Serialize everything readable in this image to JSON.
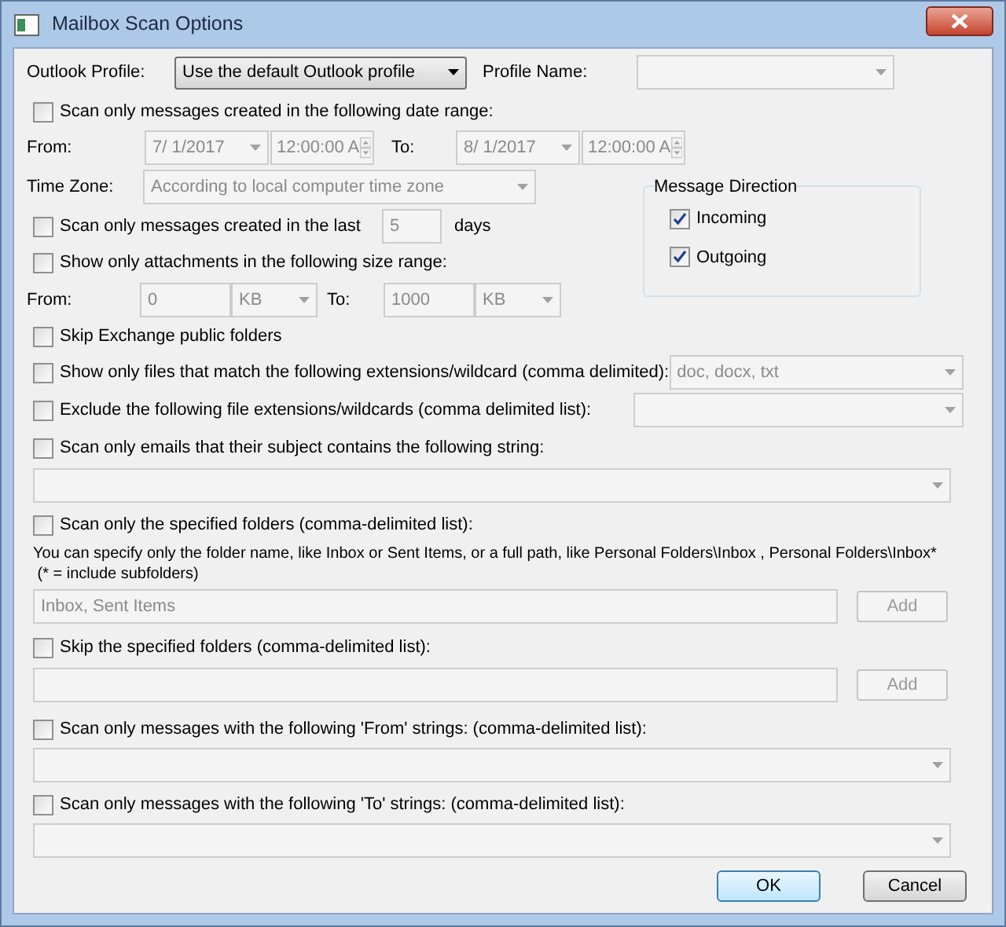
{
  "window": {
    "title": "Mailbox Scan Options"
  },
  "profile": {
    "label": "Outlook Profile:",
    "value": "Use the default Outlook profile",
    "name_label": "Profile Name:",
    "name_disabled": true
  },
  "date_range": {
    "option": {
      "label": "Scan only messages created in the following date range:",
      "checked": false
    },
    "from_label": "From:",
    "from_date": "7/  1/2017",
    "from_time": "12:00:00 A",
    "to_label": "To:",
    "to_date": "8/  1/2017",
    "to_time": "12:00:00 A",
    "disabled": true
  },
  "time_zone": {
    "label": "Time Zone:",
    "value": "According to local computer time zone",
    "disabled": true
  },
  "recent": {
    "option": {
      "label": "Scan only messages created in the last",
      "checked": false
    },
    "value": "5",
    "unit": "days",
    "disabled": true
  },
  "size_range": {
    "option": {
      "label": "Show only attachments in the following size range:",
      "checked": false
    },
    "from_label": "From:",
    "from_value": "0",
    "from_unit": "KB",
    "to_label": "To:",
    "to_value": "1000",
    "to_unit": "KB",
    "disabled": true
  },
  "message_direction": {
    "title": "Message Direction",
    "options": [
      {
        "label": "Incoming",
        "checked": true
      },
      {
        "label": "Outgoing",
        "checked": true
      }
    ]
  },
  "skip_public": {
    "label": "Skip Exchange public folders",
    "checked": false
  },
  "include_ext": {
    "option": {
      "label": "Show only files that match the following extensions/wildcard (comma delimited):",
      "checked": false
    },
    "value": "doc, docx, txt",
    "disabled": true
  },
  "exclude_ext": {
    "option": {
      "label": "Exclude the following file extensions/wildcards (comma delimited list):",
      "checked": false
    },
    "disabled": true
  },
  "subject": {
    "option": {
      "label": "Scan only emails that their subject contains the following string:",
      "checked": false
    },
    "disabled": true
  },
  "scan_folders": {
    "option": {
      "label": "Scan only the specified folders (comma-delimited list):",
      "checked": false
    },
    "hint_lines": [
      "You can specify only the folder name, like Inbox or Sent Items, or a full path, like Personal Folders\\Inbox , Personal Folders\\Inbox*",
      " (* = include subfolders)"
    ],
    "value": "Inbox, Sent Items",
    "add": "Add",
    "disabled": true
  },
  "skip_folders": {
    "option": {
      "label": "Skip the specified folders (comma-delimited list):",
      "checked": false
    },
    "add": "Add",
    "disabled": true
  },
  "from_strings": {
    "option": {
      "label": "Scan only messages with the following 'From' strings: (comma-delimited list):",
      "checked": false
    },
    "disabled": true
  },
  "to_strings": {
    "option": {
      "label": "Scan only messages with the following 'To' strings: (comma-delimited list):",
      "checked": false
    },
    "disabled": true
  },
  "buttons": [
    {
      "label": "OK",
      "default": true
    },
    {
      "label": "Cancel",
      "default": false
    }
  ]
}
